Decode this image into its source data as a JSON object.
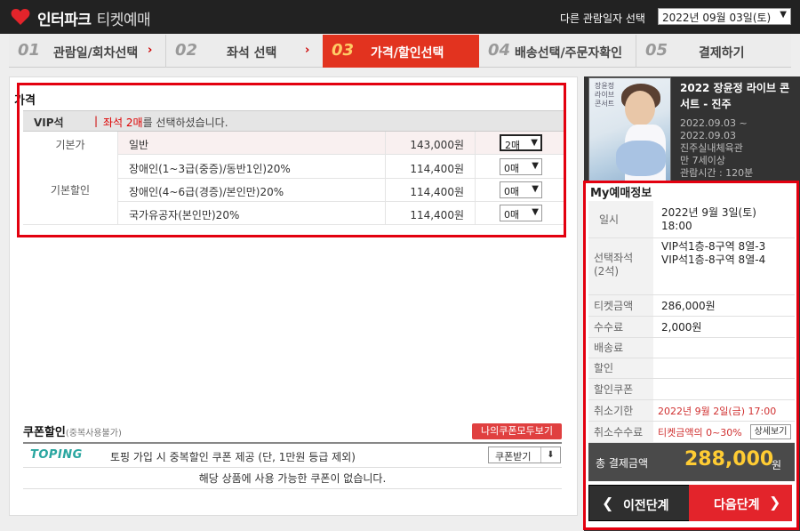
{
  "header": {
    "brand": "인터파크",
    "brand_sub": "티켓예매",
    "date_label": "다른 관람일자 선택",
    "date_value": "2022년 09월 03일(토)"
  },
  "steps": [
    {
      "num": "01",
      "label": "관람일/회차선택"
    },
    {
      "num": "02",
      "label": "좌석 선택"
    },
    {
      "num": "03",
      "label": "가격/할인선택"
    },
    {
      "num": "04",
      "label": "배송선택/주문자확인"
    },
    {
      "num": "05",
      "label": "결제하기"
    }
  ],
  "price": {
    "title": "가격",
    "grade": "VIP석",
    "sep": "|",
    "msg_red": "좌석 2매",
    "msg_rest": "를 선택하셨습니다.",
    "base_category": "기본가",
    "discount_category": "기본할인",
    "rows": [
      {
        "name": "일반",
        "price": "143,000원",
        "qty": "2매"
      },
      {
        "name": "장애인(1~3급(중증)/동반1인)20%",
        "price": "114,400원",
        "qty": "0매"
      },
      {
        "name": "장애인(4~6급(경증)/본인만)20%",
        "price": "114,400원",
        "qty": "0매"
      },
      {
        "name": "국가유공자(본인만)20%",
        "price": "114,400원",
        "qty": "0매"
      }
    ]
  },
  "coupon": {
    "title": "쿠폰할인",
    "subtitle": "(중복사용불가)",
    "view_all": "나의쿠폰모두보기",
    "brand": "TOPING",
    "desc": "토핑 가입 시 중복할인 쿠폰 제공 (단, 1만원 등급 제외)",
    "get_label": "쿠폰받기",
    "none": "해당 상품에 사용 가능한 쿠폰이 없습니다."
  },
  "show": {
    "poster_text": "장윤정 라이브 콘서트",
    "title": "2022 장윤정 라이브 콘서트 - 진주",
    "info": [
      "2022.09.03 ~",
      "2022.09.03",
      "진주실내체육관",
      "만 7세이상",
      "관람시간 : 120분"
    ]
  },
  "my": {
    "title": "My예매정보",
    "rows": {
      "date_label": "일시",
      "date_value_1": "2022년 9월 3일(토)",
      "date_value_2": "18:00",
      "seat_label_1": "선택좌석",
      "seat_label_2": "(2석)",
      "seat_1": "VIP석1층-8구역 8열-3",
      "seat_2": "VIP석1층-8구역 8열-4",
      "ticket_label": "티켓금액",
      "ticket_value": "286,000원",
      "fee_label": "수수료",
      "fee_value": "2,000원",
      "delivery_label": "배송료",
      "discount_label": "할인",
      "coupon_label": "할인쿠폰",
      "deadline_label": "취소기한",
      "deadline_value": "2022년 9월 2일(금) 17:00",
      "cancel_label": "취소수수료",
      "cancel_value": "티켓금액의 0~30%",
      "detail_btn": "상세보기"
    },
    "total_label": "총 결제금액",
    "total_value": "288,000",
    "total_unit": "원"
  },
  "buttons": {
    "prev": "이전단계",
    "next": "다음단계"
  }
}
